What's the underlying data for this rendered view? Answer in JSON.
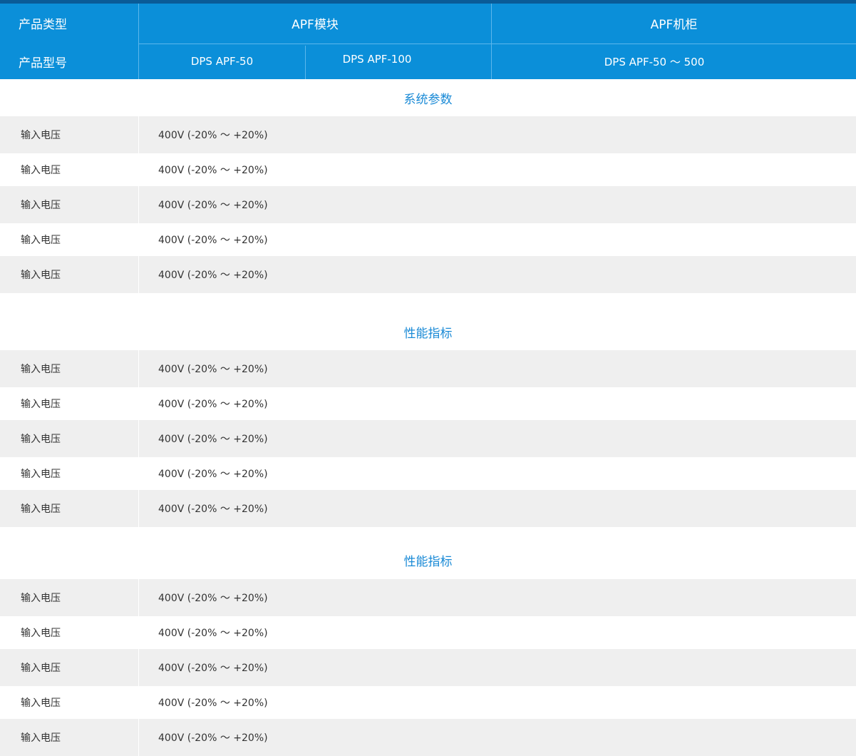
{
  "header": {
    "row1": {
      "label": "产品类型",
      "col_module": "APF模块",
      "col_cabinet": "APF机柜"
    },
    "row2": {
      "label": "产品型号",
      "model_a": "DPS APF-50",
      "model_b": "DPS APF-100",
      "model_c": "DPS APF-50 ～ 500"
    }
  },
  "sections": [
    {
      "title": "系统参数",
      "rows": [
        {
          "label": "输入电压",
          "value": "400V (-20% ～ +20%)"
        },
        {
          "label": "输入电压",
          "value": "400V (-20% ～ +20%)"
        },
        {
          "label": "输入电压",
          "value": "400V (-20% ～ +20%)"
        },
        {
          "label": "输入电压",
          "value": "400V (-20% ～ +20%)"
        },
        {
          "label": "输入电压",
          "value": "400V (-20% ～ +20%)"
        }
      ]
    },
    {
      "title": "性能指标",
      "rows": [
        {
          "label": "输入电压",
          "value": "400V (-20% ～ +20%)"
        },
        {
          "label": "输入电压",
          "value": "400V (-20% ～ +20%)"
        },
        {
          "label": "输入电压",
          "value": "400V (-20% ～ +20%)"
        },
        {
          "label": "输入电压",
          "value": "400V (-20% ～ +20%)"
        },
        {
          "label": "输入电压",
          "value": "400V (-20% ～ +20%)"
        }
      ]
    },
    {
      "title": "性能指标",
      "rows": [
        {
          "label": "输入电压",
          "value": "400V (-20% ～ +20%)"
        },
        {
          "label": "输入电压",
          "value": "400V (-20% ～ +20%)"
        },
        {
          "label": "输入电压",
          "value": "400V (-20% ～ +20%)"
        },
        {
          "label": "输入电压",
          "value": "400V (-20% ～ +20%)"
        },
        {
          "label": "输入电压",
          "value": "400V (-20% ～ +20%)"
        }
      ]
    }
  ],
  "colors": {
    "header_bg": "#0b8fd9",
    "top_line": "#0a5b97",
    "section_title": "#1a8ad6",
    "row_shade": "#efefef"
  }
}
